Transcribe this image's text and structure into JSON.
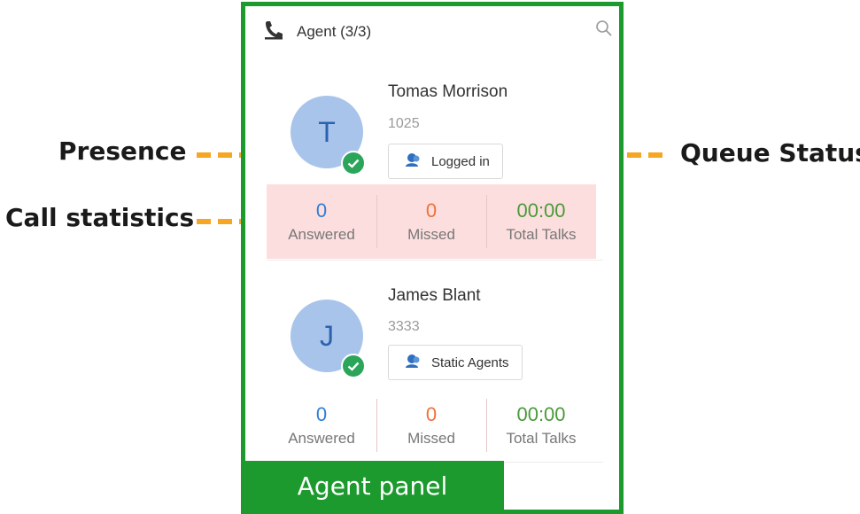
{
  "annotations": {
    "presence": "Presence",
    "call_statistics": "Call statistics",
    "queue_status": "Queue Status",
    "panel_label": "Agent panel"
  },
  "header": {
    "title": "Agent (3/3)",
    "phone_icon": "phone-icon",
    "search_icon": "search-icon"
  },
  "agents": [
    {
      "initial": "T",
      "name": "Tomas Morrison",
      "extension": "1025",
      "queue_status": "Logged in",
      "presence": "online",
      "stats": {
        "answered": "0",
        "answered_label": "Answered",
        "missed": "0",
        "missed_label": "Missed",
        "total_talks": "00:00",
        "total_talks_label": "Total Talks"
      }
    },
    {
      "initial": "J",
      "name": "James Blant",
      "extension": "3333",
      "queue_status": "Static Agents",
      "presence": "online",
      "stats": {
        "answered": "0",
        "answered_label": "Answered",
        "missed": "0",
        "missed_label": "Missed",
        "total_talks": "00:00",
        "total_talks_label": "Total Talks"
      }
    }
  ],
  "colors": {
    "panel_border": "#1d9a2e",
    "arrow": "#f5a623",
    "avatar_bg": "#a8c4ea",
    "avatar_text": "#2b62b0",
    "presence_online": "#2aa55a",
    "answered": "#2f7ed8",
    "missed": "#f0703a",
    "total_talks": "#4a9a3a",
    "stats_highlight": "#fddede"
  }
}
